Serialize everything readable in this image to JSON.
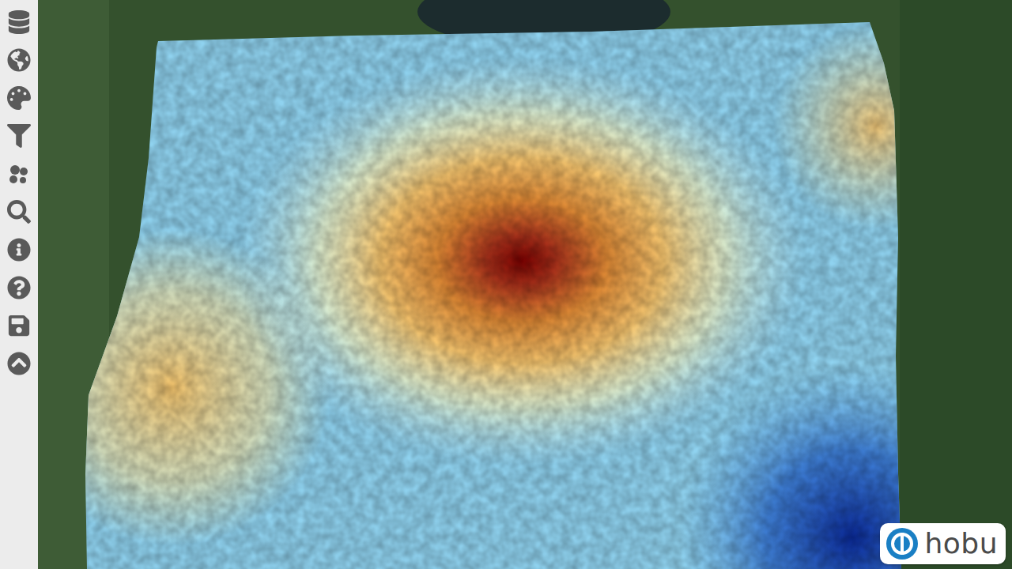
{
  "logo": {
    "text": "hobu"
  }
}
